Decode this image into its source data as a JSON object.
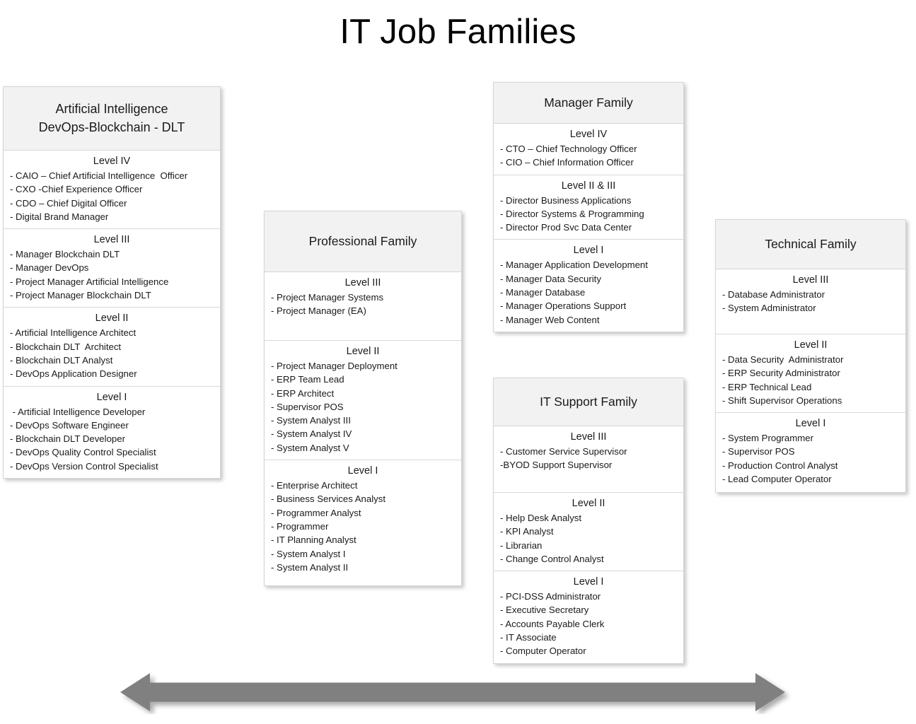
{
  "title": "IT Job Families",
  "arrow": {
    "icon": "double-headed-arrow-icon",
    "color": "#808080"
  },
  "colors": {
    "header_fill": "#F2F2F2",
    "card_border": "#D5D5D5",
    "text": "#1A1A1A",
    "arrow": "#808080"
  },
  "families": [
    {
      "id": "ai",
      "name": "Artificial Intelligence\nDevOps-Blockchain - DLT",
      "levels": [
        {
          "title": "Level IV",
          "items": [
            "- CAIO – Chief Artificial Intelligence  Officer",
            "- CXO -Chief Experience Officer",
            "- CDO – Chief Digital Officer",
            "- Digital Brand Manager"
          ]
        },
        {
          "title": "Level III",
          "items": [
            "- Manager Blockchain DLT",
            "- Manager DevOps",
            "- Project Manager Artificial Intelligence",
            "- Project Manager Blockchain DLT"
          ]
        },
        {
          "title": "Level II",
          "items": [
            "- Artificial Intelligence Architect",
            "- Blockchain DLT  Architect",
            "- Blockchain DLT Analyst",
            "- DevOps Application Designer"
          ]
        },
        {
          "title": "Level I",
          "items": [
            " - Artificial Intelligence Developer",
            "- DevOps Software Engineer",
            "- Blockchain DLT Developer",
            "- DevOps Quality Control Specialist",
            "- DevOps Version Control Specialist"
          ]
        }
      ]
    },
    {
      "id": "professional",
      "name": "Professional Family",
      "levels": [
        {
          "title": "Level  III",
          "items": [
            "- Project Manager Systems",
            "- Project Manager (EA)"
          ]
        },
        {
          "title": "Level  II",
          "items": [
            "- Project Manager Deployment",
            "- ERP Team Lead",
            "- ERP Architect",
            "- Supervisor POS",
            "- System Analyst III",
            "- System Analyst IV",
            "- System Analyst V"
          ]
        },
        {
          "title": "Level I",
          "items": [
            "- Enterprise Architect",
            "- Business Services Analyst",
            "- Programmer Analyst",
            "- Programmer",
            "- IT Planning Analyst",
            "- System Analyst I",
            "- System Analyst II"
          ]
        }
      ]
    },
    {
      "id": "manager",
      "name": "Manager Family",
      "levels": [
        {
          "title": "Level IV",
          "items": [
            "- CTO – Chief Technology Officer",
            "- CIO – Chief Information Officer"
          ]
        },
        {
          "title": "Level II & III",
          "items": [
            "- Director Business Applications",
            "- Director Systems & Programming",
            "- Director Prod Svc Data Center"
          ]
        },
        {
          "title": "Level I",
          "items": [
            "- Manager Application Development",
            "- Manager Data Security",
            "- Manager Database",
            "- Manager Operations Support",
            "- Manager Web Content"
          ]
        }
      ]
    },
    {
      "id": "itsupport",
      "name": "IT Support Family",
      "levels": [
        {
          "title": "Level III",
          "items": [
            "- Customer Service Supervisor",
            "-BYOD Support Supervisor"
          ]
        },
        {
          "title": "Level II",
          "items": [
            "- Help Desk Analyst",
            "- KPI Analyst",
            "- Librarian",
            "- Change Control Analyst"
          ]
        },
        {
          "title": "Level I",
          "items": [
            "- PCI-DSS Administrator",
            "- Executive Secretary",
            "- Accounts Payable Clerk",
            "- IT Associate",
            "- Computer Operator"
          ]
        }
      ]
    },
    {
      "id": "technical",
      "name": "Technical Family",
      "levels": [
        {
          "title": "Level III",
          "items": [
            "- Database Administrator",
            "- System Administrator"
          ]
        },
        {
          "title": "Level II",
          "items": [
            "- Data Security  Administrator",
            "- ERP Security Administrator",
            "- ERP Technical Lead",
            "- Shift Supervisor Operations"
          ]
        },
        {
          "title": "Level I",
          "items": [
            "- System Programmer",
            "- Supervisor POS",
            "- Production Control Analyst",
            "- Lead Computer Operator"
          ]
        }
      ]
    }
  ]
}
